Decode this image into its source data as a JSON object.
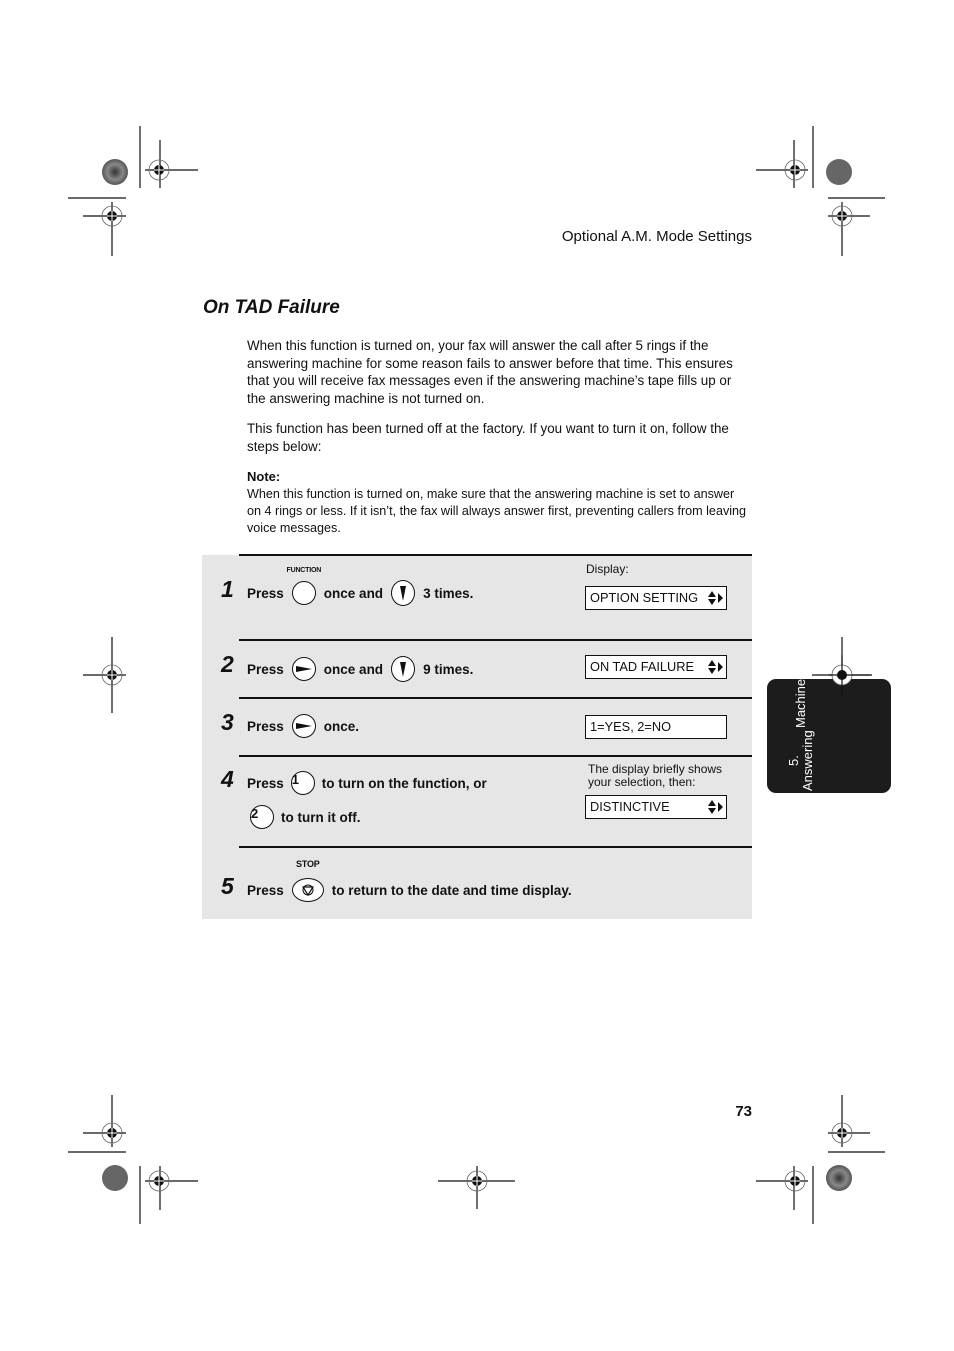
{
  "header": {
    "section_title": "Optional A.M. Mode Settings"
  },
  "title": "On TAD Failure",
  "paragraphs": [
    "When this function is turned on, your fax will answer the call after 5 rings if the answering machine for some reason fails to answer before that time. This ensures that you will receive fax messages even if the answering machine’s tape fills up or the answering machine is not turned on.",
    "This function has been turned off at the factory. If you want to turn it on, follow the steps below:"
  ],
  "note": {
    "label": "Note:",
    "text": "When this function is turned on, make sure that the answering machine is set to answer on 4 rings or less. If it isn’t, the fax will always answer first, preventing callers from leaving voice messages."
  },
  "steps": [
    {
      "number": "1",
      "press": "Press",
      "button1_label": "FUNCTION",
      "button1_icon": "function-button-icon",
      "mid": "once and",
      "button2_icon": "down-arrow-button-icon",
      "end": "3 times.",
      "display_label": "Display:",
      "display": "OPTION SETTING",
      "display_icon": "up-down-right-arrows-icon"
    },
    {
      "number": "2",
      "press": "Press",
      "button1_icon": "right-arrow-button-icon",
      "mid": "once and",
      "button2_icon": "down-arrow-button-icon",
      "end": "9 times.",
      "display": "ON TAD FAILURE",
      "display_icon": "up-down-right-arrows-icon"
    },
    {
      "number": "3",
      "press": "Press",
      "button1_icon": "right-arrow-button-icon",
      "end": "once.",
      "display": "1=YES, 2=NO"
    },
    {
      "number": "4",
      "press": "Press",
      "key1": "1",
      "mid": "to turn on the function, or",
      "key2": "2",
      "end": "to turn it off.",
      "display_label": "The display briefly shows your selection, then:",
      "display": "DISTINCTIVE",
      "display_icon": "up-down-right-arrows-icon"
    },
    {
      "number": "5",
      "press": "Press",
      "button1_label": "STOP",
      "button1_icon": "stop-button-icon",
      "end": "to return to the date and time display."
    }
  ],
  "side_tab": {
    "line1": "5. Answering",
    "line2": "Machine"
  },
  "page_number": "73"
}
